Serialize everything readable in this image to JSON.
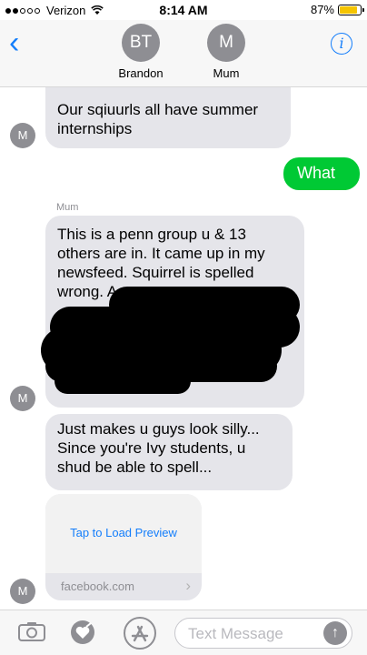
{
  "status_bar": {
    "carrier": "Verizon",
    "time": "8:14 AM",
    "battery_percent": "87%",
    "battery_level": 0.87,
    "signal_bars": 2,
    "signal_total": 5,
    "wifi_icon": "wifi-icon"
  },
  "header": {
    "back_icon": "chevron-left-icon",
    "contacts": [
      {
        "initials": "BT",
        "name": "Brandon"
      },
      {
        "initials": "M",
        "name": "Mum"
      }
    ],
    "info_icon": "info-icon",
    "info_label": "i"
  },
  "messages": {
    "m1": {
      "text": "Our sqiuurls all have summer internships",
      "direction": "incoming"
    },
    "m2": {
      "text": "What",
      "direction": "outgoing"
    },
    "m3_sender": "Mum",
    "m3": {
      "text": "This is a penn group u & 13 others are in. It came up in my newsfeed. Squirrel is spelled wrong. A",
      "direction": "incoming",
      "redacted": true
    },
    "m4": {
      "text": "Just makes u guys look silly... Since you're Ivy students, u shud be able to spell...",
      "direction": "incoming"
    },
    "link_preview": {
      "action": "Tap to Load Preview",
      "domain": "facebook.com"
    },
    "avatar_initial": "M"
  },
  "input_bar": {
    "placeholder": "Text Message",
    "send_label": "↑",
    "icons": [
      "camera-icon",
      "digital-touch-icon",
      "app-store-icon",
      "send-icon"
    ]
  },
  "colors": {
    "accent": "#147efb",
    "outgoing_bubble": "#00c934",
    "incoming_bubble": "#e5e5ea",
    "avatar": "#8e8e93"
  }
}
